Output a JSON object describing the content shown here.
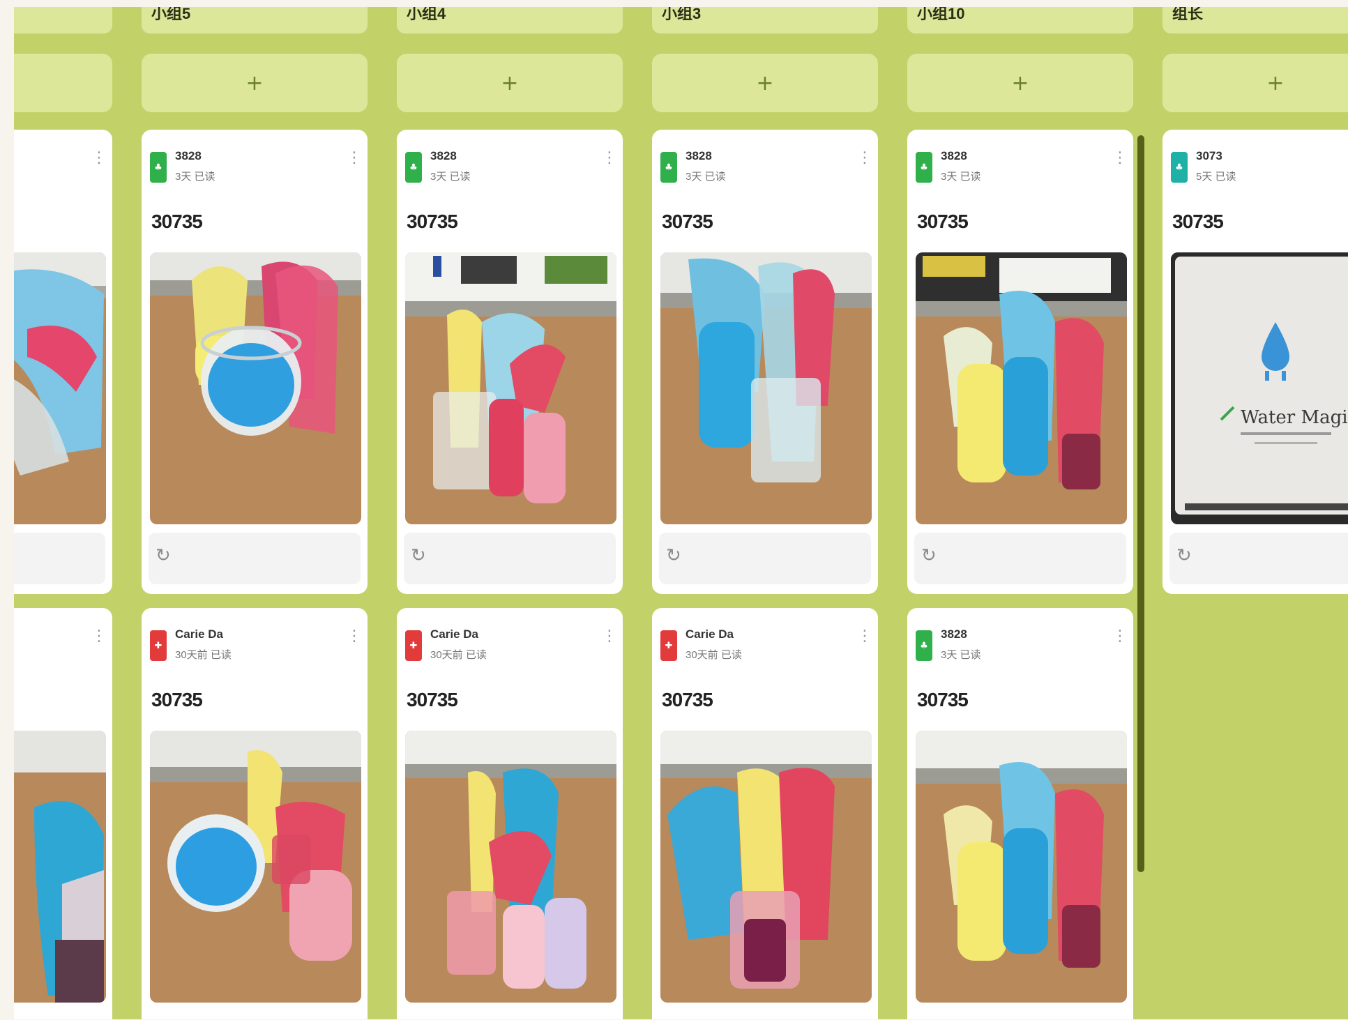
{
  "board": {
    "colors": {
      "background": "#c3d268",
      "column_header": "#dde79a",
      "card": "#ffffff",
      "divider": "#576018"
    },
    "columns": [
      {
        "header": "",
        "add_label": "",
        "cards": [
          {
            "author": "",
            "time": "",
            "title": "",
            "photo": "paper-craft-photo",
            "avatar_color": "#ffffff",
            "avatar_icon": ""
          },
          {
            "author": "",
            "time": "",
            "title": "",
            "photo": "paper-craft-photo",
            "avatar_color": "#ffffff",
            "avatar_icon": ""
          }
        ]
      },
      {
        "header": "小组5",
        "add_label": "+",
        "cards": [
          {
            "author": "3828",
            "time": "3天 已读",
            "title": "30735",
            "photo": "paper-craft-photo",
            "avatar_color": "#2fb04a",
            "avatar_icon": "♣"
          },
          {
            "author": "Carie Da",
            "time": "30天前 已读",
            "title": "30735",
            "photo": "paper-craft-photo",
            "avatar_color": "#e23b3b",
            "avatar_icon": "✚"
          }
        ]
      },
      {
        "header": "小组4",
        "add_label": "+",
        "cards": [
          {
            "author": "3828",
            "time": "3天 已读",
            "title": "30735",
            "photo": "paper-craft-photo",
            "avatar_color": "#2fb04a",
            "avatar_icon": "♣"
          },
          {
            "author": "Carie Da",
            "time": "30天前 已读",
            "title": "30735",
            "photo": "paper-craft-photo",
            "avatar_color": "#e23b3b",
            "avatar_icon": "✚"
          }
        ]
      },
      {
        "header": "小组3",
        "add_label": "+",
        "cards": [
          {
            "author": "3828",
            "time": "3天 已读",
            "title": "30735",
            "photo": "paper-craft-photo",
            "avatar_color": "#2fb04a",
            "avatar_icon": "♣"
          },
          {
            "author": "Carie Da",
            "time": "30天前 已读",
            "title": "30735",
            "photo": "paper-craft-photo",
            "avatar_color": "#e23b3b",
            "avatar_icon": "✚"
          }
        ]
      },
      {
        "header": "小组10",
        "add_label": "+",
        "cards": [
          {
            "author": "3828",
            "time": "3天 已读",
            "title": "30735",
            "photo": "paper-craft-photo",
            "avatar_color": "#2fb04a",
            "avatar_icon": "♣"
          },
          {
            "author": "3828",
            "time": "3天 已读",
            "title": "30735",
            "photo": "paper-craft-photo",
            "avatar_color": "#2fb04a",
            "avatar_icon": "♣"
          }
        ]
      },
      {
        "header": "组长",
        "add_label": "+",
        "cards": [
          {
            "author": "3073",
            "time": "5天 已读",
            "title": "30735",
            "photo": "water-magic-slide",
            "slide_text": "Water Magic",
            "avatar_color": "#1fb0a6",
            "avatar_icon": "♣"
          }
        ]
      }
    ]
  },
  "icons": {
    "menu": "kebab-menu-icon",
    "comment": "comment-icon",
    "add": "plus-icon"
  }
}
